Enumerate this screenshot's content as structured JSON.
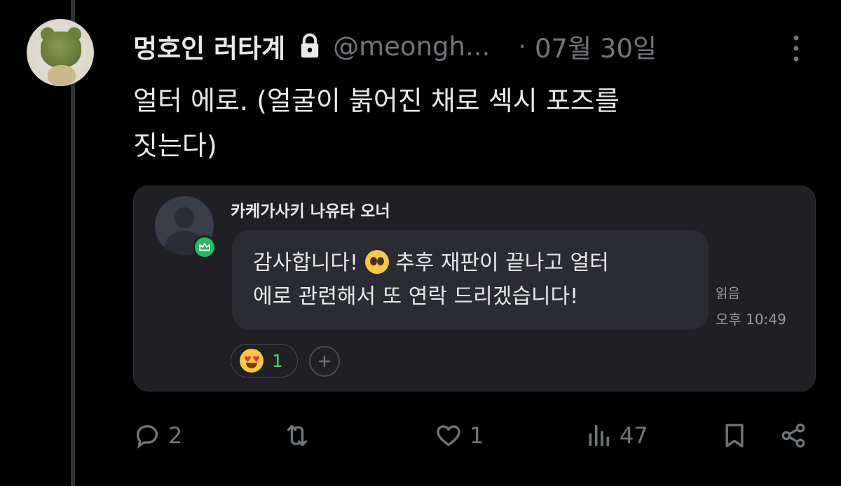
{
  "tweet": {
    "display_name": "멍호인 러타계",
    "protected_icon": "lock-icon",
    "handle": "@meongh...",
    "separator": "·",
    "date": "07월 30일",
    "text_line1": "얼터 에로. (얼굴이 붉어진 채로 섹시 포즈를",
    "text_line2": "짓는다)"
  },
  "chat_card": {
    "sender_name": "카케가사키 나유타 오너",
    "badge_icon": "crown-icon",
    "message_part1": "감사합니다!",
    "message_emoji": "pleading-face-emoji",
    "message_part2": "추후 재판이 끝나고 얼터",
    "message_line2": "에로 관련해서 또 연락 드리겠습니다!",
    "read_status": "읽음",
    "time": "오후 10:49",
    "reaction": {
      "emoji": "heart-eyes-emoji",
      "count": "1"
    },
    "add_reaction_icon": "plus-icon"
  },
  "actions": {
    "reply": {
      "icon": "reply-icon",
      "count": "2"
    },
    "retweet": {
      "icon": "retweet-icon",
      "count": ""
    },
    "like": {
      "icon": "heart-icon",
      "count": "1"
    },
    "views": {
      "icon": "views-icon",
      "count": "47"
    },
    "bookmark": {
      "icon": "bookmark-icon"
    },
    "share": {
      "icon": "share-icon"
    }
  },
  "colors": {
    "background": "#000000",
    "text_primary": "#e7e9ea",
    "text_secondary": "#71767b",
    "card_bg": "#1f1f24",
    "bubble_bg": "#2b2c33",
    "badge_green": "#27b860",
    "reaction_count": "#4bd27a"
  }
}
